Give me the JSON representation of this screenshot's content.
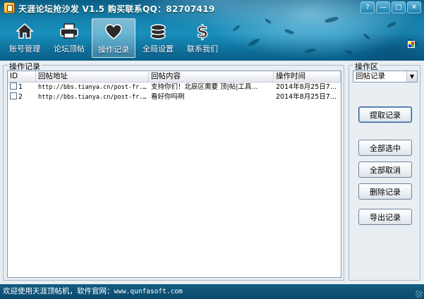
{
  "window": {
    "title": "天涯论坛抢沙发 V1.5 购买联系QQ：82707419",
    "controls": [
      "?",
      "—",
      "□",
      "✕"
    ]
  },
  "toolbar": {
    "items": [
      {
        "label": "账号管理",
        "icon": "home-icon",
        "active": false
      },
      {
        "label": "论坛顶帖",
        "icon": "printer-icon",
        "active": false
      },
      {
        "label": "操作记录",
        "icon": "heart-icon",
        "active": true
      },
      {
        "label": "全局设置",
        "icon": "coins-icon",
        "active": false
      },
      {
        "label": "联系我们",
        "icon": "dollar-icon",
        "active": false
      }
    ]
  },
  "records": {
    "group_title": "操作记录",
    "columns": [
      "ID",
      "回帖地址",
      "回帖内容",
      "操作时间"
    ],
    "rows": [
      {
        "id": "1",
        "url": "http://bbs.tianya.cn/post-fr...",
        "content": "支持你们！北辰区需要 顶|帖|工具...",
        "time": "2014年8月25日7..."
      },
      {
        "id": "2",
        "url": "http://bbs.tianya.cn/post-fr...",
        "content": "看好你吗咧",
        "time": "2014年8月25日7..."
      }
    ]
  },
  "ops": {
    "group_title": "操作区",
    "select_value": "回帖记录",
    "buttons": {
      "fetch": "提取记录",
      "select_all": "全部选中",
      "deselect_all": "全部取消",
      "delete": "删除记录",
      "export": "导出记录"
    }
  },
  "status": {
    "prefix": "欢迎使用天涯顶帖机，软件官网：",
    "site": "www.qunfasoft.com"
  },
  "colors": {
    "header": "#1684b0",
    "status_bar": "#0b4a6c",
    "panel_bg": "#e9eef3"
  }
}
